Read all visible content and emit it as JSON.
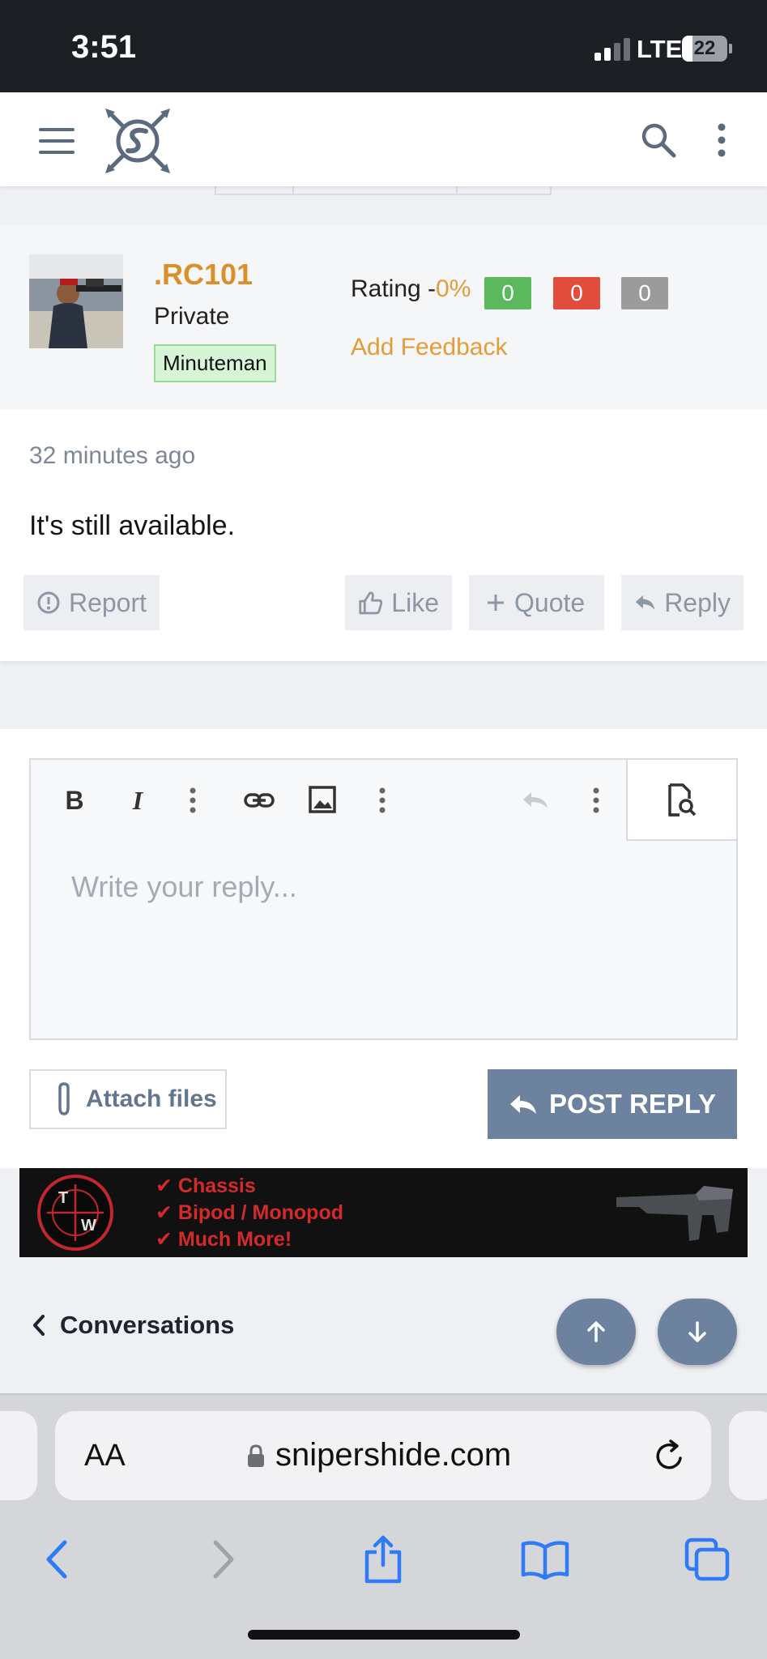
{
  "status_bar": {
    "time": "3:51",
    "network": "LTE",
    "battery": "22"
  },
  "header": {
    "menu_icon": "hamburger-icon",
    "logo": "sniper-logo",
    "search_icon": "search-icon",
    "more_icon": "kebab-icon"
  },
  "post": {
    "username": ".RC101",
    "user_title": "Private",
    "user_banner": "Minuteman",
    "rating_label": "Rating -",
    "rating_pct": "0%",
    "badges": [
      {
        "value": "0",
        "color": "#5cb85c"
      },
      {
        "value": "0",
        "color": "#e24c3d"
      },
      {
        "value": "0",
        "color": "#9b9b9b"
      }
    ],
    "add_feedback": "Add Feedback",
    "time": "32 minutes ago",
    "message": "It's still available.",
    "actions": {
      "report": "Report",
      "like": "Like",
      "quote": "Quote",
      "reply": "Reply"
    }
  },
  "editor": {
    "placeholder": "Write your reply...",
    "attach_label": "Attach files",
    "post_reply_label": "POST REPLY"
  },
  "ad": {
    "items": [
      "✔ Chassis",
      "✔ Bipod / Monopod",
      "✔ Much More!"
    ],
    "logo_letters": [
      "T",
      "W"
    ]
  },
  "footer_nav": {
    "back_label": "Conversations"
  },
  "safari": {
    "aa": "AA",
    "domain": "snipershide.com"
  },
  "colors": {
    "accent": "#6c829e",
    "username": "#d98f2a"
  }
}
